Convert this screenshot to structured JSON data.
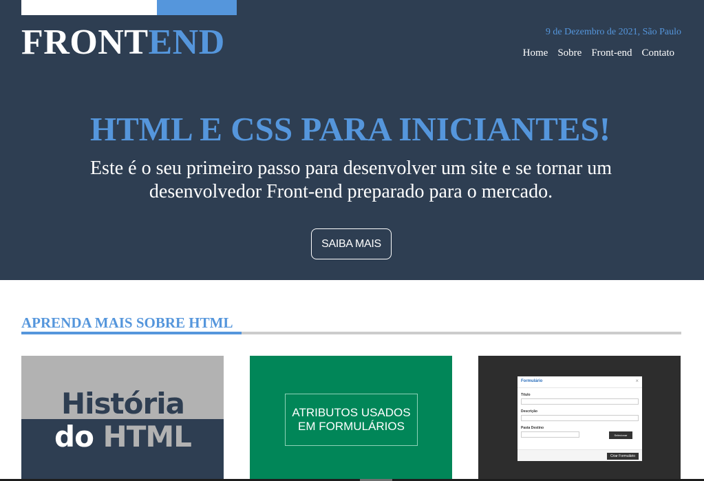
{
  "header": {
    "logo_part_a": "FRONT",
    "logo_part_b": "END",
    "date_location": "9 de Dezembro de 2021, São Paulo",
    "nav": [
      "Home",
      "Sobre",
      "Front-end",
      "Contato"
    ]
  },
  "hero": {
    "title": "HTML E CSS PARA INICIANTES!",
    "subtitle": "Este é o seu primeiro passo para desenvolver um site e se tornar um desenvolvedor Front-end preparado para o mercado.",
    "cta_label": "SAIBA MAIS"
  },
  "section": {
    "title": "APRENDA MAIS SOBRE HTML"
  },
  "cards": [
    {
      "line1": "História",
      "line2_a": "do ",
      "line2_b": "HTML"
    },
    {
      "text": "ATRIBUTOS USADOS EM FORMULÁRIOS"
    },
    {
      "modal_title": "Formulário",
      "close": "×",
      "label_titulo": "Título",
      "label_descricao": "Descrição",
      "label_pasta": "Pasta Destino",
      "upload": "Selecionar",
      "submit": "Criar Formulário"
    }
  ],
  "colors": {
    "hero_bg": "#2e3e52",
    "accent": "#5596dc",
    "card2_bg": "#018658"
  }
}
